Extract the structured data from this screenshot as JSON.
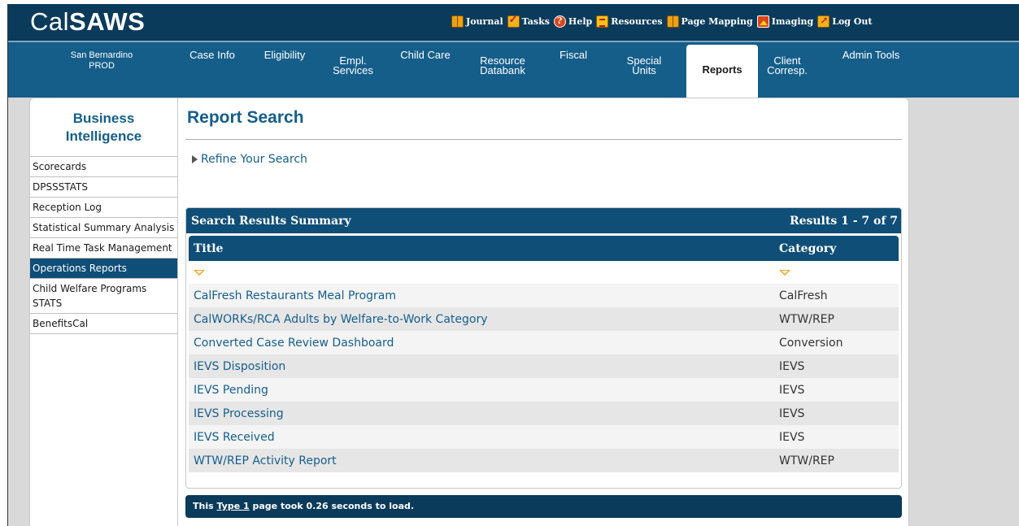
{
  "logo": {
    "prefix": "Cal",
    "suffix": "SAWS"
  },
  "utility_links": [
    {
      "label": "Journal",
      "icon": "journal-icon"
    },
    {
      "label": "Tasks",
      "icon": "tasks-icon"
    },
    {
      "label": "Help",
      "icon": "help-icon"
    },
    {
      "label": "Resources",
      "icon": "resources-icon"
    },
    {
      "label": "Page Mapping",
      "icon": "page-mapping-icon"
    },
    {
      "label": "Imaging",
      "icon": "imaging-icon"
    },
    {
      "label": "Log Out",
      "icon": "log-out-icon"
    }
  ],
  "county": {
    "line1": "San Bernardino",
    "line2": "PROD"
  },
  "tabs": [
    {
      "line1": "Case Info",
      "line2": ""
    },
    {
      "line1": "Eligibility",
      "line2": ""
    },
    {
      "line1": "Empl.",
      "line2": "Services"
    },
    {
      "line1": "Child Care",
      "line2": ""
    },
    {
      "line1": "Resource",
      "line2": "Databank"
    },
    {
      "line1": "Fiscal",
      "line2": ""
    },
    {
      "line1": "Special",
      "line2": "Units"
    },
    {
      "line1": "Reports",
      "line2": "",
      "active": true
    },
    {
      "line1": "Client",
      "line2": "Corresp."
    },
    {
      "line1": "Admin Tools",
      "line2": ""
    }
  ],
  "sidebar": {
    "title_line1": "Business",
    "title_line2": "Intelligence",
    "items": [
      {
        "label": "Scorecards"
      },
      {
        "label": "DPSSSTATS"
      },
      {
        "label": "Reception Log"
      },
      {
        "label": "Statistical Summary Analysis"
      },
      {
        "label": "Real Time Task Management"
      },
      {
        "label": "Operations Reports",
        "active": true
      },
      {
        "label": "Child Welfare Programs STATS"
      },
      {
        "label": "BenefitsCal"
      }
    ]
  },
  "main": {
    "title": "Report Search",
    "refine_label": "Refine Your Search",
    "results": {
      "summary_title": "Search Results Summary",
      "count_text": "Results 1 - 7 of 7",
      "columns": [
        "Title",
        "Category"
      ],
      "rows": [
        {
          "title": "CalFresh Restaurants Meal Program",
          "category": "CalFresh"
        },
        {
          "title": "CalWORKs/RCA Adults by Welfare-to-Work Category",
          "category": "WTW/REP"
        },
        {
          "title": "Converted Case Review Dashboard",
          "category": "Conversion"
        },
        {
          "title": "IEVS Disposition",
          "category": "IEVS"
        },
        {
          "title": "IEVS Pending",
          "category": "IEVS"
        },
        {
          "title": "IEVS Processing",
          "category": "IEVS"
        },
        {
          "title": "IEVS Received",
          "category": "IEVS"
        },
        {
          "title": "WTW/REP Activity Report",
          "category": "WTW/REP"
        }
      ]
    },
    "footer": {
      "pre": "This ",
      "link": "Type 1",
      "post": " page took 0.26 seconds to load."
    }
  },
  "colors": {
    "header_dark": "#0b3b5b",
    "nav_blue": "#155e8a",
    "table_header": "#0f4e77",
    "link": "#155e8a",
    "sort_arrow": "#f0a020"
  }
}
